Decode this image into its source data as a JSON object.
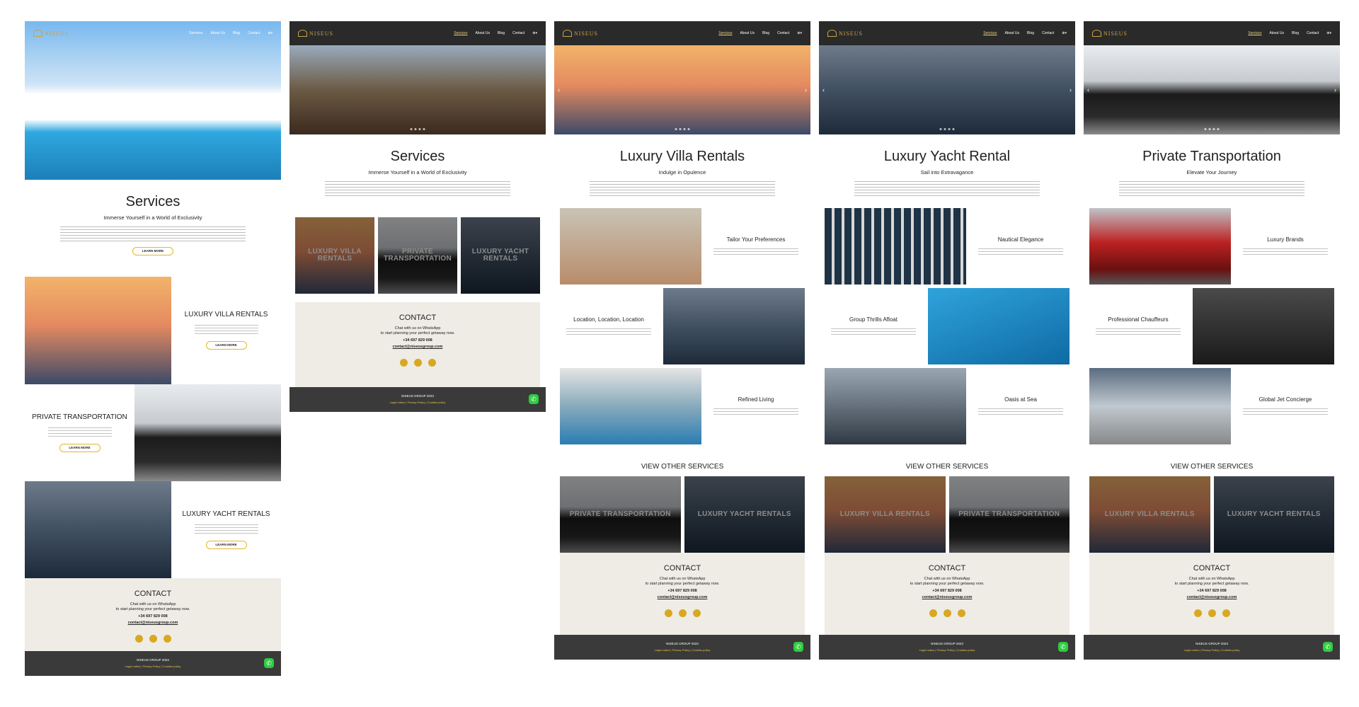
{
  "nav": {
    "logo": "NISEUS",
    "items": [
      "Services",
      "About Us",
      "Blog",
      "Contact"
    ],
    "lang_icon": "globe-icon"
  },
  "col1": {
    "title": "Services",
    "subtitle": "Immerse Yourself in a World of Exclusivity",
    "learn": "LEARN MORE",
    "sections": [
      {
        "title": "LUXURY VILLA RENTALS",
        "btn": "LEARN MORE"
      },
      {
        "title": "PRIVATE TRANSPORTATION",
        "btn": "LEARN MORE"
      },
      {
        "title": "LUXURY YACHT RENTALS",
        "btn": "LEARN MORE"
      }
    ]
  },
  "col2": {
    "title": "Services",
    "subtitle": "Immerse Yourself in a World of Exclusivity",
    "cards": [
      "LUXURY VILLA RENTALS",
      "PRIVATE TRANSPORTATION",
      "LUXURY YACHT RENTALS"
    ]
  },
  "col3": {
    "title": "Luxury Villa Rentals",
    "subtitle": "Indulge in Opulence",
    "features": [
      "Tailor Your Preferences",
      "Location, Location, Location",
      "Refined Living"
    ],
    "other": "VIEW OTHER SERVICES",
    "cards": [
      "PRIVATE TRANSPORTATION",
      "LUXURY YACHT RENTALS"
    ]
  },
  "col4": {
    "title": "Luxury Yacht Rental",
    "subtitle": "Sail into Extravagance",
    "features": [
      "Nautical Elegance",
      "Group Thrills Afloat",
      "Oasis at Sea"
    ],
    "other": "VIEW OTHER SERVICES",
    "cards": [
      "LUXURY VILLA RENTALS",
      "PRIVATE TRANSPORTATION"
    ]
  },
  "col5": {
    "title": "Private Transportation",
    "subtitle": "Elevate Your Journey",
    "features": [
      "Luxury Brands",
      "Professional Chauffeurs",
      "Global Jet Concierge"
    ],
    "other": "VIEW OTHER SERVICES",
    "cards": [
      "LUXURY VILLA RENTALS",
      "LUXURY YACHT RENTALS"
    ]
  },
  "contact": {
    "title": "CONTACT",
    "line1": "Chat with us on WhatsApp",
    "line2": "to start planning your perfect getaway now.",
    "phone": "+34 697 829 008",
    "email": "contact@niseusgroup.com"
  },
  "footer": {
    "copy": "NISEUS GROUP 2023",
    "links": "Legal notice  |  Privacy Policy  |  Cookies policy"
  },
  "colors": {
    "accent": "#e0b928",
    "footer": "#3a3a3a",
    "nav": "#2a2a2a",
    "contact_bg": "#efece6",
    "whatsapp": "#2ecc40"
  }
}
